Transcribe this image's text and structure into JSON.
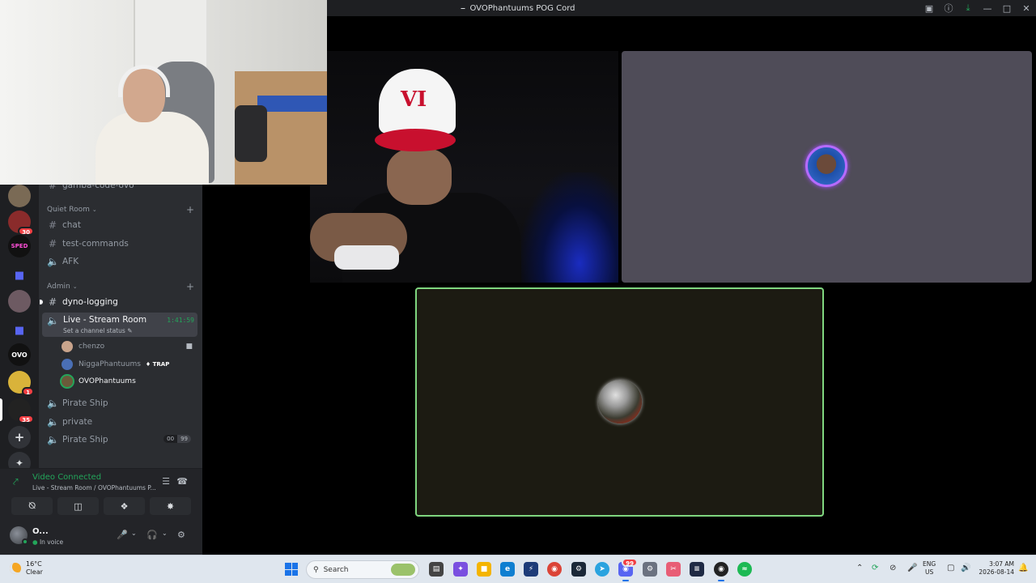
{
  "window": {
    "title": "OVOPhantuums POG Cord"
  },
  "sidebar": {
    "top_channel": "gamba-code-ovo",
    "categories": {
      "quiet_room": "Quiet Room",
      "admin": "Admin"
    },
    "channels": {
      "chat": "chat",
      "test_commands": "test-commands",
      "afk": "AFK",
      "dyno_logging": "dyno-logging",
      "pirate_ship_1": "Pirate Ship",
      "private": "private",
      "pirate_ship_2": "Pirate Ship"
    },
    "live_room": {
      "name": "Live - Stream Room",
      "status": "Set a channel status",
      "timer": "1:41:59"
    },
    "voice_users": [
      {
        "name": "chenzo"
      },
      {
        "name": "NiggaPhantuums",
        "tag": "TRAP"
      },
      {
        "name": "OVOPhantuums"
      }
    ],
    "pirate_ship_counts": {
      "current": "00",
      "limit": "99"
    }
  },
  "rail": {
    "badges": {
      "server_2": "30",
      "server_9": "1",
      "server_10": "35"
    },
    "labels": {
      "server_3": "SPED",
      "server_8": "OVO"
    }
  },
  "voice_panel": {
    "title": "Video Connected",
    "subtitle": "Live - Stream Room / OVOPhantuums P..."
  },
  "user_panel": {
    "name": "O...",
    "status": "In voice"
  },
  "taskbar": {
    "weather_temp": "16°C",
    "weather_desc": "Clear",
    "search_placeholder": "Search",
    "discord_badge": "99",
    "lang_1": "ENG",
    "lang_2": "US",
    "time": "3:07 AM",
    "date": "2026-08-14"
  },
  "icons": {
    "accent_green": "#23a55a",
    "speaking_border": "#7fd67f",
    "avatar_ring": "#b66bff"
  }
}
